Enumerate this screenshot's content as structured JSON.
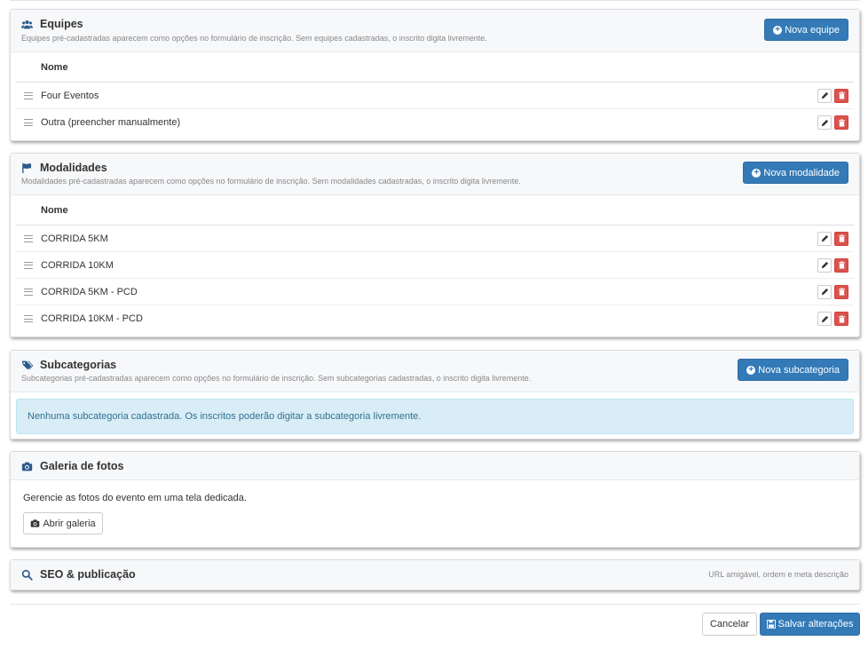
{
  "equipes": {
    "title": "Equipes",
    "icon": "users-icon",
    "subtitle": "Equipes pré-cadastradas aparecem como opções no formulário de inscrição. Sem equipes cadastradas, o inscrito digita livremente.",
    "add_label": "Nova equipe",
    "column": "Nome",
    "rows": [
      "Four Eventos",
      "Outra (preencher manualmente)"
    ]
  },
  "modalidades": {
    "title": "Modalidades",
    "icon": "flag-icon",
    "subtitle": "Modalidades pré-cadastradas aparecem como opções no formulário de inscrição. Sem modalidades cadastradas, o inscrito digita livremente.",
    "add_label": "Nova modalidade",
    "column": "Nome",
    "rows": [
      "CORRIDA 5KM",
      "CORRIDA 10KM",
      "CORRIDA 5KM - PCD",
      "CORRIDA 10KM - PCD"
    ]
  },
  "subcategorias": {
    "title": "Subcategorias",
    "icon": "tags-icon",
    "subtitle": "Subcategorias pré-cadastradas aparecem como opções no formulário de inscrição. Sem subcategorias cadastradas, o inscrito digita livremente.",
    "add_label": "Nova subcategoria",
    "empty_message": "Nenhuma subcategoria cadastrada. Os inscritos poderão digitar a subcategoria livremente."
  },
  "galeria": {
    "title": "Galeria de fotos",
    "icon": "camera-icon",
    "description": "Gerencie as fotos do evento em uma tela dedicada.",
    "button_label": "Abrir galeria"
  },
  "seo": {
    "title": "SEO & publicação",
    "icon": "search-icon",
    "hint": "URL amigável, ordem e meta descrição"
  },
  "footer": {
    "cancel_label": "Cancelar",
    "save_label": "Salvar alterações"
  },
  "colors": {
    "primary": "#337ab7",
    "danger": "#d9534f",
    "info_bg": "#d9edf7",
    "info_text": "#31708f"
  }
}
